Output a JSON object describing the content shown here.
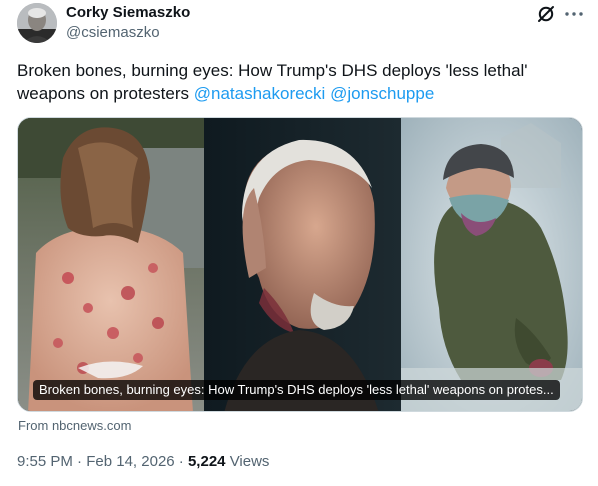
{
  "author": {
    "display_name": "Corky Siemaszko",
    "handle": "@csiemaszko",
    "avatar_icon": "person-avatar"
  },
  "header_actions": {
    "grok_icon": "grok-slash-icon",
    "more_icon": "more-dots-icon"
  },
  "tweet": {
    "text": "Broken bones, burning eyes: How Trump's DHS deploys 'less lethal' weapons on protesters",
    "mentions": [
      "@natashakorecki",
      "@jonschuppe"
    ]
  },
  "link_card": {
    "headline": "Broken bones, burning eyes: How Trump's DHS deploys 'less lethal' weapons on protes...",
    "source": "From nbcnews.com"
  },
  "meta": {
    "time": "9:55 PM",
    "separator": "·",
    "date": "Feb 14, 2026",
    "views_count": "5,224",
    "views_label": "Views"
  },
  "colors": {
    "accent": "#1d9bf0",
    "text": "#0f1419",
    "secondary": "#536471"
  }
}
